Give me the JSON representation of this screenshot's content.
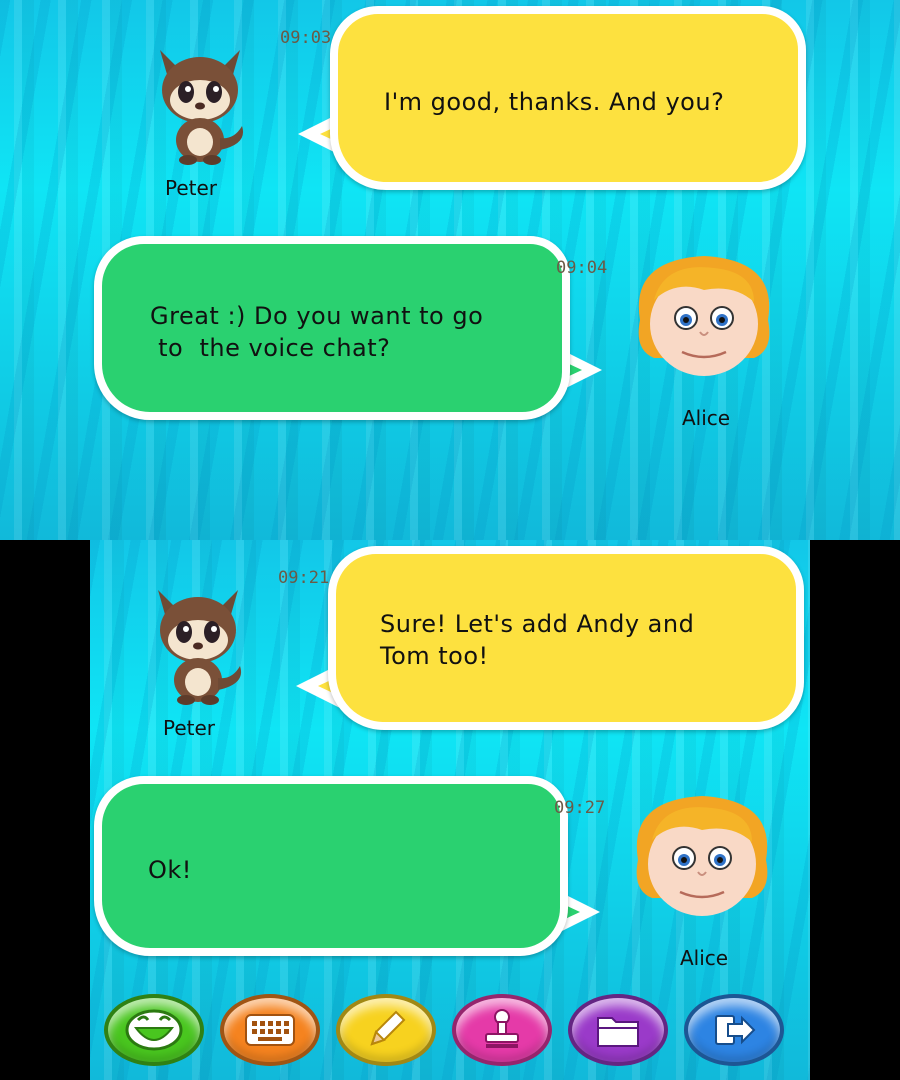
{
  "top_screen": {
    "messages": [
      {
        "sender": "Peter",
        "time": "09:03",
        "text_lines": [
          "I'm good, thanks. And you?"
        ]
      },
      {
        "sender": "Alice",
        "time": "09:04",
        "text_lines": [
          "Great :) Do you want to go",
          " to  the voice chat?"
        ]
      }
    ]
  },
  "bottom_screen": {
    "messages": [
      {
        "sender": "Peter",
        "time": "09:21",
        "text_lines": [
          "Sure! Let's add Andy and",
          "Tom too!"
        ]
      },
      {
        "sender": "Alice",
        "time": "09:27",
        "text_lines": [
          "Ok!"
        ]
      }
    ],
    "toolbar": [
      {
        "icon": "smile-icon",
        "color": "#49c61f"
      },
      {
        "icon": "keyboard-icon",
        "color": "#f5831f"
      },
      {
        "icon": "pencil-icon",
        "color": "#f7d21f"
      },
      {
        "icon": "stamp-icon",
        "color": "#e53aa8"
      },
      {
        "icon": "folder-icon",
        "color": "#9a3ac9"
      },
      {
        "icon": "exit-icon",
        "color": "#2d84e3"
      }
    ]
  },
  "colors": {
    "background": "#12c7e8",
    "peter_bubble": "#fde13f",
    "alice_bubble": "#2ad170"
  }
}
